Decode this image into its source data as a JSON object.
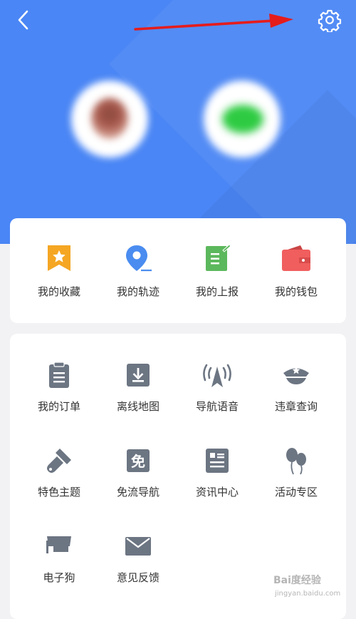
{
  "header": {
    "background_color": "#4a86f5",
    "back_icon": "chevron-left-icon",
    "settings_icon": "gear-icon",
    "annotation_arrow_color": "#e51c1c"
  },
  "accounts": [
    {
      "name": "user-avatar",
      "blurred": true
    },
    {
      "name": "wechat-avatar",
      "blurred": true
    }
  ],
  "quick_actions": [
    {
      "label": "我的收藏",
      "icon": "bookmark-star-icon",
      "color": "#f5a623"
    },
    {
      "label": "我的轨迹",
      "icon": "map-pin-icon",
      "color": "#4a8cf0"
    },
    {
      "label": "我的上报",
      "icon": "report-document-icon",
      "color": "#5cb85c"
    },
    {
      "label": "我的钱包",
      "icon": "wallet-icon",
      "color": "#f05e5e"
    }
  ],
  "tools": [
    {
      "label": "我的订单",
      "icon": "clipboard-icon"
    },
    {
      "label": "离线地图",
      "icon": "download-box-icon"
    },
    {
      "label": "导航语音",
      "icon": "broadcast-icon"
    },
    {
      "label": "违章查询",
      "icon": "police-cap-icon"
    },
    {
      "label": "特色主题",
      "icon": "paintbrush-icon"
    },
    {
      "label": "免流导航",
      "icon": "free-badge-icon",
      "glyph": "免"
    },
    {
      "label": "资讯中心",
      "icon": "news-icon"
    },
    {
      "label": "活动专区",
      "icon": "balloons-icon"
    },
    {
      "label": "电子狗",
      "icon": "camera-icon"
    },
    {
      "label": "意见反馈",
      "icon": "envelope-icon"
    }
  ],
  "icon_gray": "#6c7582",
  "watermark": {
    "name": "Bai度经验",
    "site": "jingyan.baidu.com"
  }
}
